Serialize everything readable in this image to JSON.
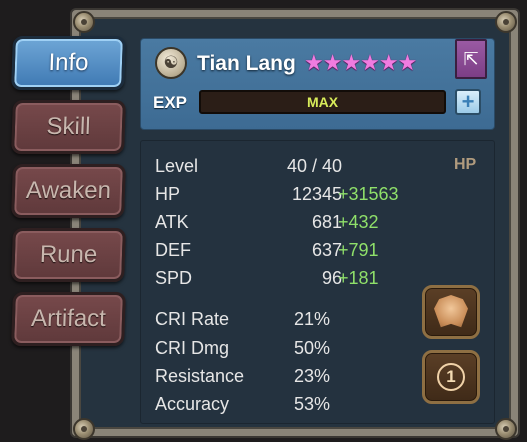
{
  "tabs": [
    {
      "label": "Info",
      "active": true
    },
    {
      "label": "Skill",
      "active": false
    },
    {
      "label": "Awaken",
      "active": false
    },
    {
      "label": "Rune",
      "active": false
    },
    {
      "label": "Artifact",
      "active": false
    }
  ],
  "monster": {
    "name": "Tian Lang",
    "stars": "★★★★★★",
    "star_count": 6,
    "element_icon": "wind-element-icon",
    "exp_label": "EXP",
    "exp_value": "MAX"
  },
  "stats": {
    "level_label": "Level",
    "level_value": "40 / 40",
    "hp_tag": "HP",
    "base": [
      {
        "label": "HP",
        "value": "12345",
        "bonus": "+31563"
      },
      {
        "label": "ATK",
        "value": "681",
        "bonus": "+432"
      },
      {
        "label": "DEF",
        "value": "637",
        "bonus": "+791"
      },
      {
        "label": "SPD",
        "value": "96",
        "bonus": "+181"
      }
    ],
    "secondary": [
      {
        "label": "CRI Rate",
        "value": "21%"
      },
      {
        "label": "CRI Dmg",
        "value": "50%"
      },
      {
        "label": "Resistance",
        "value": "23%"
      },
      {
        "label": "Accuracy",
        "value": "53%"
      }
    ],
    "lock_number": "1"
  },
  "colors": {
    "active_tab": "#4f8cc6",
    "inactive_tab": "#6b4244",
    "bonus_green": "#8fe06a",
    "star_pink": "#f07ce0",
    "exp_text": "#d8ec5a"
  }
}
